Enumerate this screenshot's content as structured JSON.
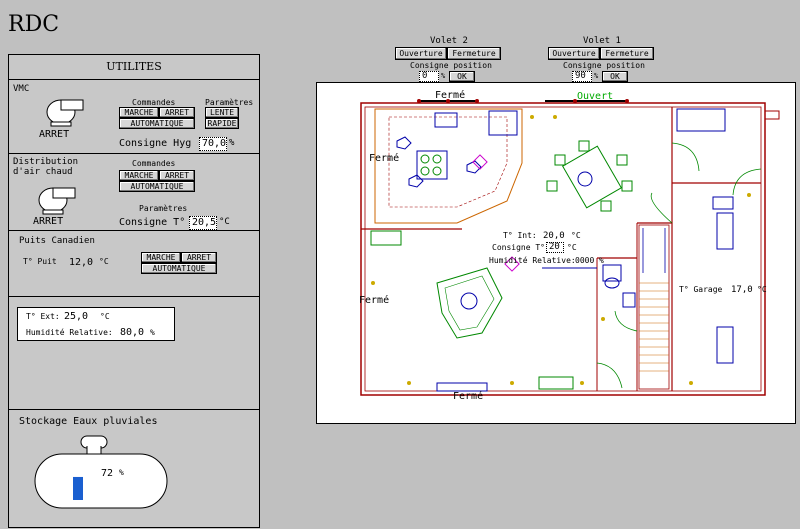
{
  "page": {
    "title": "RDC"
  },
  "utilites": {
    "header": "UTILITES",
    "vmc": {
      "label": "VMC",
      "state": "ARRET",
      "commandes_label": "Commandes",
      "parametres_label": "Paramètres",
      "marche": "MARCHE",
      "arret": "ARRET",
      "automatique": "AUTOMATIQUE",
      "lente": "LENTE",
      "rapide": "RAPIDE",
      "consigne_label": "Consigne Hyg",
      "consigne_value": "70,0",
      "consigne_unit": "%"
    },
    "air": {
      "label_line1": "Distribution",
      "label_line2": "d'air chaud",
      "state": "ARRET",
      "commandes_label": "Commandes",
      "parametres_label": "Paramètres",
      "marche": "MARCHE",
      "arret": "ARRET",
      "automatique": "AUTOMATIQUE",
      "consigne_label": "Consigne T°",
      "consigne_value": "20,5",
      "consigne_unit": "°C"
    },
    "puits": {
      "label": "Puits Canadien",
      "temp_label": "T° Puit",
      "temp_value": "12,0",
      "temp_unit": "°C",
      "marche": "MARCHE",
      "arret": "ARRET",
      "automatique": "AUTOMATIQUE"
    },
    "exterieur": {
      "temp_label": "T° Ext:",
      "temp_value": "25,0",
      "temp_unit": "°C",
      "hum_label": "Humidité Relative:",
      "hum_value": "80,0",
      "hum_unit": "%"
    },
    "stockage": {
      "label": "Stockage Eaux pluviales",
      "level_value": "72",
      "level_unit": "%",
      "level_fraction": 0.72
    }
  },
  "volets": [
    {
      "title": "Volet 2",
      "ouverture": "Ouverture",
      "fermeture": "Fermeture",
      "consigne_label": "Consigne position",
      "value": "0",
      "unit": "%",
      "ok": "OK"
    },
    {
      "title": "Volet 1",
      "ouverture": "Ouverture",
      "fermeture": "Fermeture",
      "consigne_label": "Consigne position",
      "value": "90",
      "unit": "%",
      "ok": "OK"
    }
  ],
  "plan": {
    "ferme_top": "Fermé",
    "ouvert_top": "Ouvert",
    "ferme_left1": "Fermé",
    "ferme_left2": "Fermé",
    "ferme_bottom": "Fermé",
    "t_int_label": "T° Int:",
    "t_int_value": "20,0",
    "t_int_unit": "°C",
    "consigne_label": "Consigne T°:",
    "consigne_value": "20",
    "consigne_unit": "°C",
    "hum_label": "Humidité Relative:",
    "hum_value": "0000",
    "hum_unit": "%",
    "garage_label": "T° Garage",
    "garage_value": "17,0",
    "garage_unit": "°C",
    "colors": {
      "wall": "#a00000",
      "furniture": "#0000aa",
      "plant": "#008800",
      "shutter_open": "#00aa00",
      "tank_fill": "#1a5fd0"
    }
  }
}
